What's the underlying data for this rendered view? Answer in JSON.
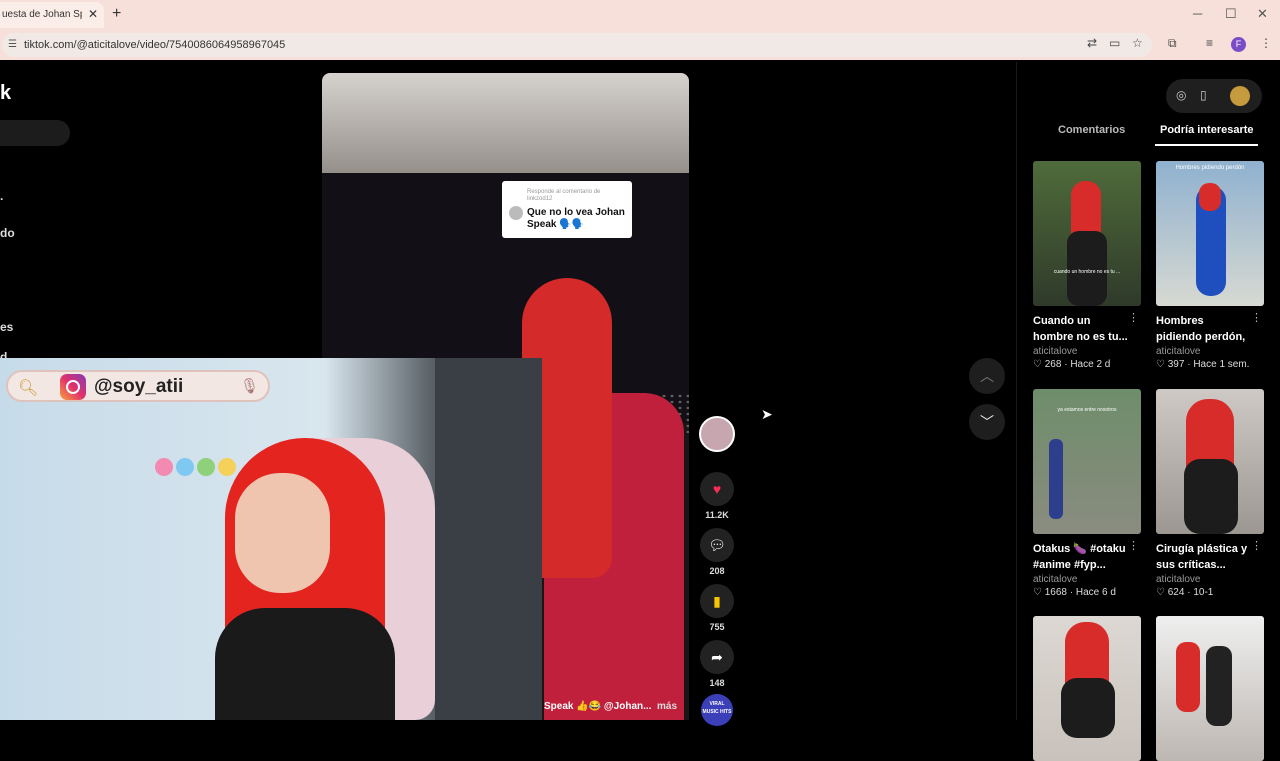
{
  "browser": {
    "tab_title": "uesta de Johan Speak",
    "tab_close": "✕",
    "new_tab": "+",
    "url": "tiktok.com/@aticitalove/video/7540086064958967045",
    "window_controls": [
      "─",
      "☐",
      "✕"
    ]
  },
  "left_nav": {
    "logo": "k",
    "items": [
      "·",
      "do",
      "es",
      "d"
    ]
  },
  "video": {
    "reply_header": "Responde al comentario de linkzod12",
    "reply_text": "Que no lo vea Johan Speak 🗣️🗣️",
    "caption": "Speak 👍😂 @Johan...",
    "caption_more": "más",
    "music_disc_text": "VIRAL MUSIC HITS"
  },
  "overlay": {
    "handle": "@soy_atii"
  },
  "actions": {
    "likes": "11.2K",
    "comments": "208",
    "saves": "755",
    "shares": "148"
  },
  "right_panel": {
    "tabs": [
      "Comentarios",
      "Podría interesarte"
    ],
    "active_tab": "Podría interesarte",
    "cards": [
      {
        "title": "Cuando un hombre no es tu...",
        "author": "aticitalove",
        "likes": "268",
        "age": "Hace 2 d",
        "thumb_text": "cuando un hombre no es tu ..."
      },
      {
        "title": "Hombres pidiendo perdón, confirme...",
        "author": "aticitalove",
        "likes": "397",
        "age": "Hace 1 sem.",
        "thumb_text": "Hombres pidiendo perdón"
      },
      {
        "title": "Otakus 🍆 #otaku #anime #fyp...",
        "author": "aticitalove",
        "likes": "1668",
        "age": "Hace 6 d",
        "thumb_text": "ya estamos entre nosotros"
      },
      {
        "title": "Cirugía plástica y sus críticas...",
        "author": "aticitalove",
        "likes": "624",
        "age": "10-1",
        "thumb_text": ""
      },
      {
        "title": "",
        "author": "",
        "likes": "",
        "age": "",
        "thumb_text": ""
      },
      {
        "title": "",
        "author": "",
        "likes": "",
        "age": "",
        "thumb_text": ""
      }
    ]
  },
  "colors": {
    "like": "#fe2c55",
    "save": "#f7c600",
    "tabbar": "#f6e0d9"
  }
}
